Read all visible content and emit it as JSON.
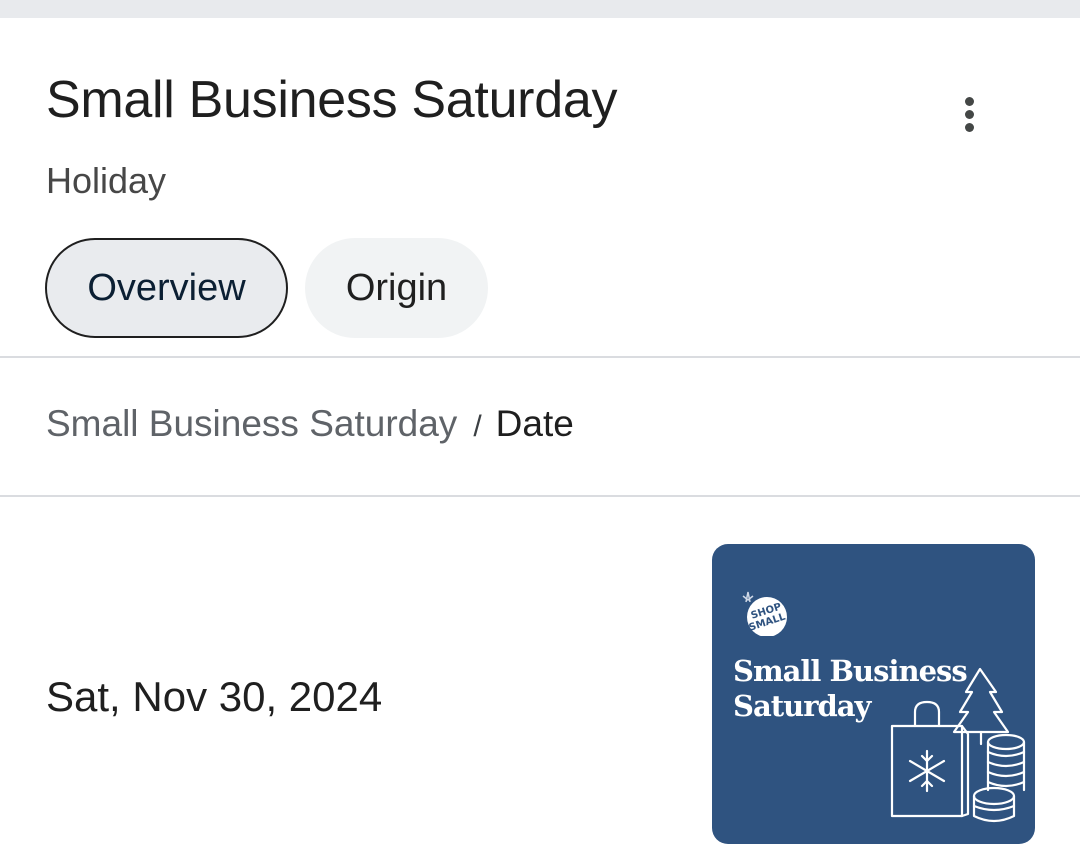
{
  "header": {
    "title": "Small Business Saturday",
    "subtitle": "Holiday",
    "menu_icon": "more-vert-icon"
  },
  "tabs": [
    {
      "label": "Overview",
      "selected": true
    },
    {
      "label": "Origin",
      "selected": false
    }
  ],
  "breadcrumb": {
    "parent": "Small Business Saturday",
    "separator": "/",
    "current": "Date"
  },
  "answer": {
    "date": "Sat, Nov 30, 2024"
  },
  "thumbnail": {
    "badge_text": "SHOP SMALL",
    "title_line1": "Small Business",
    "title_line2": "Saturday"
  },
  "colors": {
    "thumbnail_background": "#2f5380",
    "selected_chip_background": "#e9ebee",
    "top_bar": "#e8eaed"
  }
}
